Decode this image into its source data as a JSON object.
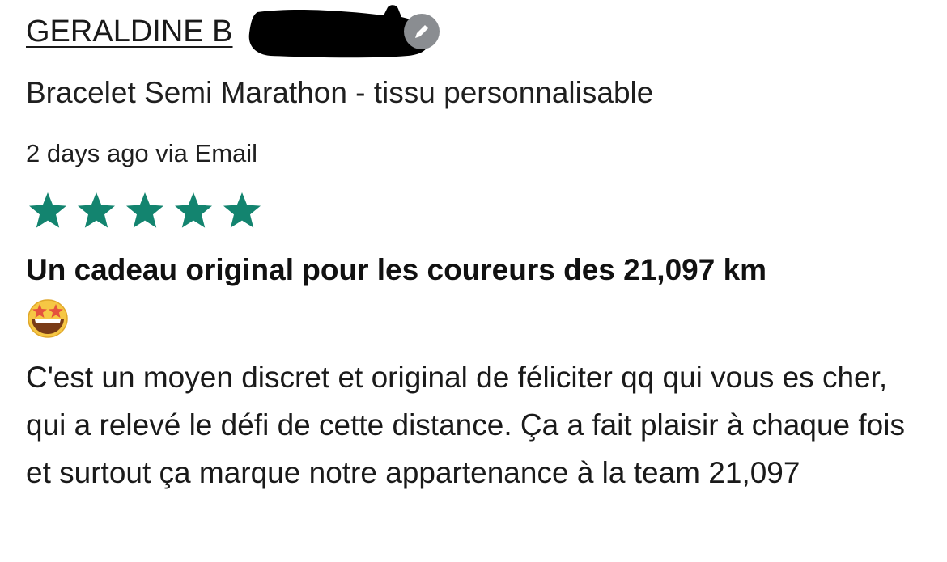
{
  "review": {
    "author_name": "GERALDINE B",
    "product_title": "Bracelet Semi Marathon - tissu personnalisable",
    "meta": "2 days ago via Email",
    "rating": 5,
    "rating_max": 5,
    "star_color": "#13846f",
    "headline": "Un cadeau original pour les coureurs des 21,097 km",
    "headline_emoji": "star-struck-emoji",
    "body": "C'est un moyen discret et original de féliciter qq qui vous es cher, qui a relevé le défi de cette distance. Ça a fait plaisir à chaque fois et surtout ça marque notre appartenance à la team 21,097"
  },
  "icons": {
    "edit": "pencil-icon",
    "star": "star-icon"
  }
}
